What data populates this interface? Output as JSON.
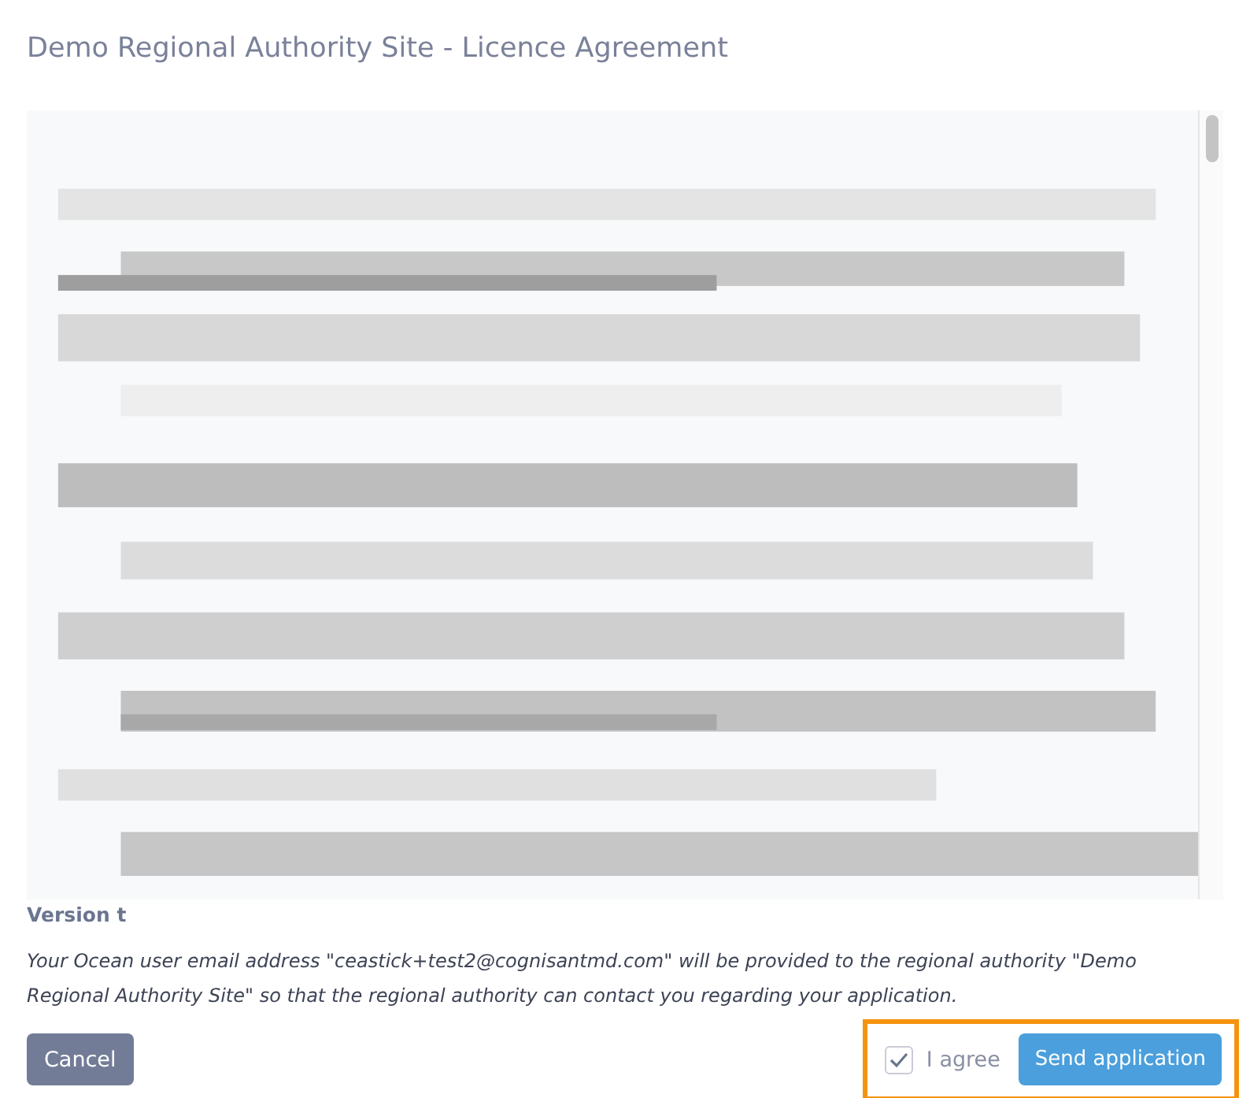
{
  "title": "Demo Regional Authority Site - Licence Agreement",
  "version": "Version t",
  "notice": "Your Ocean user email address \"ceastick+test2@cognisantmd.com\" will be provided to the regional authority \"Demo Regional Authority Site\" so that the regional authority can contact you regarding your application.",
  "cancel_button": "Cancel",
  "agree": {
    "label": "I agree",
    "checked": true
  },
  "send_button": "Send application"
}
